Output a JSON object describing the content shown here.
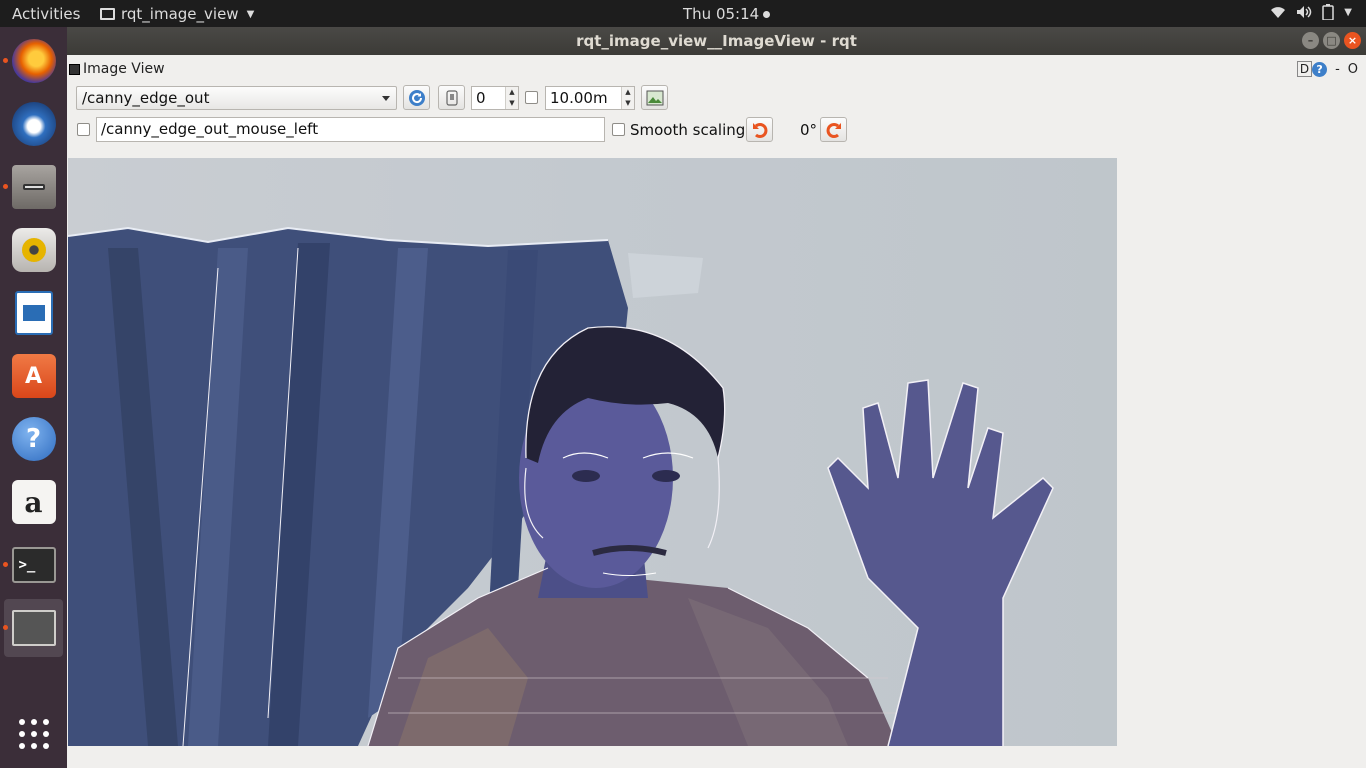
{
  "topbar": {
    "activities": "Activities",
    "app_name": "rqt_image_view",
    "clock": "Thu 05:14"
  },
  "dock": {
    "items": [
      {
        "name": "firefox",
        "icon": "firefox-icon",
        "color": "#e66000",
        "running": true
      },
      {
        "name": "thunderbird",
        "icon": "thunderbird-icon",
        "color": "#2f6fbf",
        "running": false
      },
      {
        "name": "files",
        "icon": "files-icon",
        "color": "#8e8a86",
        "running": true
      },
      {
        "name": "rhythmbox",
        "icon": "rhythmbox-icon",
        "color": "#e6b400",
        "running": false
      },
      {
        "name": "libreoffice-writer",
        "icon": "writer-icon",
        "color": "#2a6db5",
        "running": false
      },
      {
        "name": "ubuntu-software",
        "icon": "software-icon",
        "color": "#e95420",
        "running": false
      },
      {
        "name": "help",
        "icon": "help-icon",
        "color": "#3b7fd0",
        "running": false
      },
      {
        "name": "amazon",
        "icon": "amazon-icon",
        "color": "#f0efed",
        "running": false
      },
      {
        "name": "terminal",
        "icon": "terminal-icon",
        "color": "#2b2b2b",
        "running": true
      },
      {
        "name": "rqt",
        "icon": "window-icon",
        "color": "#555555",
        "running": true
      }
    ]
  },
  "window": {
    "title": "rqt_image_view__ImageView - rqt"
  },
  "plugin": {
    "title": "Image View",
    "help_d": "D",
    "help_q": "?",
    "ctl_minimize": "-",
    "ctl_close": "O"
  },
  "toolbar": {
    "topic": "/canny_edge_out",
    "spin_value": "0",
    "rate_value": "10.00m",
    "mouse_topic": "/canny_edge_out_mouse_left",
    "smooth_label": "Smooth scaling",
    "rotation": "0°"
  },
  "colors": {
    "accent": "#e95420",
    "panel": "#f0efed",
    "curtain": "#3f4f7a"
  }
}
